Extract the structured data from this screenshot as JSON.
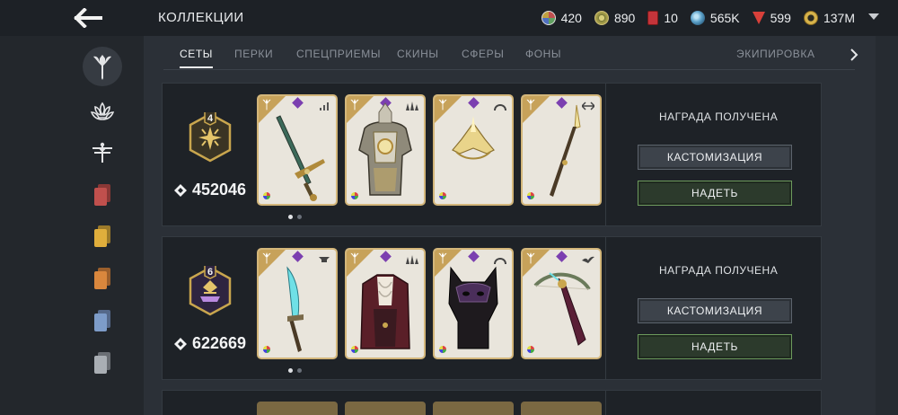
{
  "header": {
    "title": "КОЛЛЕКЦИИ",
    "back_icon": "arrow-left-icon",
    "currencies": [
      {
        "icon": "multicolor-orb-icon",
        "value": "420",
        "color": "#b08bd0"
      },
      {
        "icon": "sun-token-icon",
        "value": "890",
        "color": "#c4b65a"
      },
      {
        "icon": "red-gem-icon",
        "value": "10",
        "color": "#c4343a"
      },
      {
        "icon": "swirl-icon",
        "value": "565K",
        "color": "#5aa0c8"
      },
      {
        "icon": "ruby-icon",
        "value": "599",
        "color": "#d8403a"
      },
      {
        "icon": "gold-coin-icon",
        "value": "137M",
        "color": "#d6b24a"
      }
    ],
    "menu_icon": "caret-down-icon"
  },
  "sidebar": {
    "items": [
      {
        "icon": "sword-emblem-icon",
        "active": true
      },
      {
        "icon": "lotus-icon",
        "active": false
      },
      {
        "icon": "dragonfly-icon",
        "active": false
      },
      {
        "icon": "red-cards-icon",
        "color": "#c0504d"
      },
      {
        "icon": "yellow-cards-icon",
        "color": "#d9a83a"
      },
      {
        "icon": "orange-cards-icon",
        "color": "#d9873d"
      },
      {
        "icon": "blue-cards-icon",
        "color": "#7d9cc9"
      },
      {
        "icon": "grey-cards-icon",
        "color": "#9ea3aa"
      }
    ]
  },
  "tabs": [
    {
      "label": "СЕТЫ",
      "active": true
    },
    {
      "label": "ПЕРКИ",
      "active": false
    },
    {
      "label": "СПЕЦПРИЕМЫ",
      "active": false
    },
    {
      "label": "СКИНЫ",
      "active": false
    },
    {
      "label": "СФЕРЫ",
      "active": false
    },
    {
      "label": "ФОНЫ",
      "active": false
    },
    {
      "label": "ЭКИПИРОВКА",
      "active": false
    }
  ],
  "sets": [
    {
      "level": "4",
      "score": "452046",
      "badge_color": "#d6b24a",
      "reward_text": "НАГРАДА ПОЛУЧЕНА",
      "customize_label": "КАСТОМИЗАЦИЯ",
      "equip_label": "НАДЕТЬ",
      "cards": [
        {
          "item": "sword-icon",
          "stat_icon": "signal-bars-icon"
        },
        {
          "item": "armor-icon",
          "stat_icon": "triple-peaks-icon"
        },
        {
          "item": "crown-helmet-icon",
          "stat_icon": "arc-icon"
        },
        {
          "item": "spear-icon",
          "stat_icon": "arrows-split-icon"
        }
      ]
    },
    {
      "level": "6",
      "score": "622669",
      "badge_color": "#a56ad8",
      "reward_text": "НАГРАДА ПОЛУЧЕНА",
      "customize_label": "КАСТОМИЗАЦИЯ",
      "equip_label": "НАДЕТЬ",
      "cards": [
        {
          "item": "blade-icon",
          "stat_icon": "anvil-icon"
        },
        {
          "item": "coat-armor-icon",
          "stat_icon": "triple-peaks-icon"
        },
        {
          "item": "wolf-mask-icon",
          "stat_icon": "arc-icon"
        },
        {
          "item": "crossbow-icon",
          "stat_icon": "bird-icon"
        }
      ]
    }
  ]
}
